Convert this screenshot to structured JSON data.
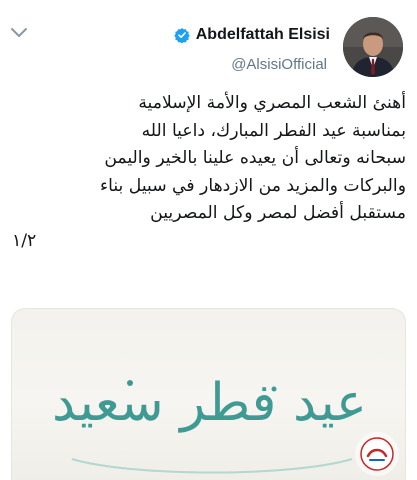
{
  "author": {
    "display_name": "Abdelfattah Elsisi",
    "handle": "@AlsisiOfficial",
    "verified": true
  },
  "tweet": {
    "lines": [
      "أهنئ الشعب المصري والأمة الإسلامية",
      "بمناسبة عيد الفطر المبارك، داعيا الله",
      "سبحانه وتعالى أن يعيده علينا بالخير واليمن",
      "والبركات والمزيد من الازدهار في سبيل بناء",
      "مستقبل أفضل لمصر وكل المصريين",
      "١/٢"
    ]
  },
  "media_card": {
    "greeting": "عيد فطر سعيد"
  },
  "icons": {
    "menu": "chevron-down-icon",
    "verified": "verified-badge-icon",
    "watermark": "source-logo-icon"
  },
  "colors": {
    "verified_blue": "#1da1f2",
    "handle_gray": "#657786",
    "greeting_teal": "#3f9a94"
  }
}
